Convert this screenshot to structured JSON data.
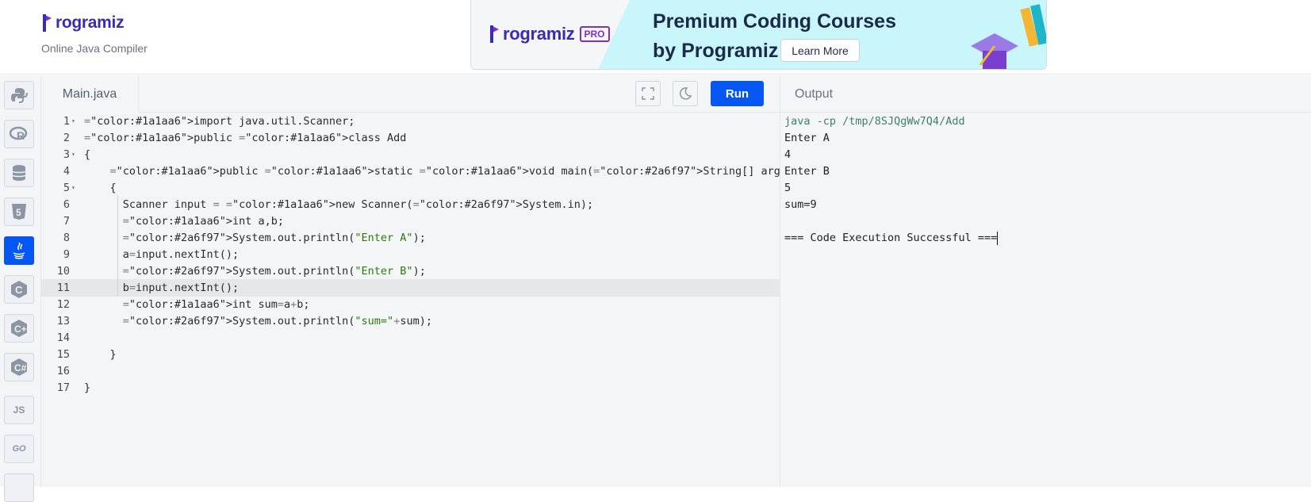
{
  "header": {
    "logo_text": "rogramiz",
    "subtitle": "Online Java Compiler",
    "banner": {
      "logo_text": "rogramiz",
      "badge": "PRO",
      "title_line1": "Premium Coding Courses",
      "title_line2": "by Programiz",
      "button": "Learn More"
    }
  },
  "sidebar": {
    "items": [
      {
        "name": "python-icon",
        "glyph": "🐍"
      },
      {
        "name": "r-icon",
        "glyph": "R"
      },
      {
        "name": "sql-icon",
        "glyph": "≡"
      },
      {
        "name": "html-icon",
        "glyph": "5"
      },
      {
        "name": "java-icon",
        "glyph": "☕",
        "active": true
      },
      {
        "name": "c-icon",
        "glyph": "C"
      },
      {
        "name": "cpp-icon",
        "glyph": "C"
      },
      {
        "name": "csharp-icon",
        "glyph": "C"
      },
      {
        "name": "js-icon",
        "glyph": "JS"
      },
      {
        "name": "go-icon",
        "glyph": "GO"
      }
    ]
  },
  "editor": {
    "file_tab": "Main.java",
    "run_label": "Run",
    "active_line": 11,
    "lines": [
      {
        "n": "1",
        "fold": true,
        "text": "import java.util.Scanner;"
      },
      {
        "n": "2",
        "fold": false,
        "text": "public class Add"
      },
      {
        "n": "3",
        "fold": true,
        "text": "{"
      },
      {
        "n": "4",
        "fold": false,
        "text": "    public static void main(String[] args)"
      },
      {
        "n": "5",
        "fold": true,
        "text": "    {"
      },
      {
        "n": "6",
        "fold": false,
        "text": "      Scanner input = new Scanner(System.in);"
      },
      {
        "n": "7",
        "fold": false,
        "text": "      int a,b;"
      },
      {
        "n": "8",
        "fold": false,
        "text": "      System.out.println(\"Enter A\");"
      },
      {
        "n": "9",
        "fold": false,
        "text": "      a=input.nextInt();"
      },
      {
        "n": "10",
        "fold": false,
        "text": "      System.out.println(\"Enter B\");"
      },
      {
        "n": "11",
        "fold": false,
        "text": "      b=input.nextInt();"
      },
      {
        "n": "12",
        "fold": false,
        "text": "      int sum=a+b;"
      },
      {
        "n": "13",
        "fold": false,
        "text": "      System.out.println(\"sum=\"+sum);"
      },
      {
        "n": "14",
        "fold": false,
        "text": ""
      },
      {
        "n": "15",
        "fold": false,
        "text": "    }"
      },
      {
        "n": "16",
        "fold": false,
        "text": ""
      },
      {
        "n": "17",
        "fold": false,
        "text": "}"
      }
    ]
  },
  "output": {
    "title": "Output",
    "lines": [
      "java -cp /tmp/8SJQgWw7Q4/Add",
      "Enter A",
      "4",
      "Enter B",
      "5",
      "sum=9",
      "",
      "=== Code Execution Successful ==="
    ]
  },
  "colors": {
    "accent": "#0556f3",
    "keyword": "#1a1aa6",
    "string": "#2b7a0b",
    "type": "#2a6f97"
  }
}
